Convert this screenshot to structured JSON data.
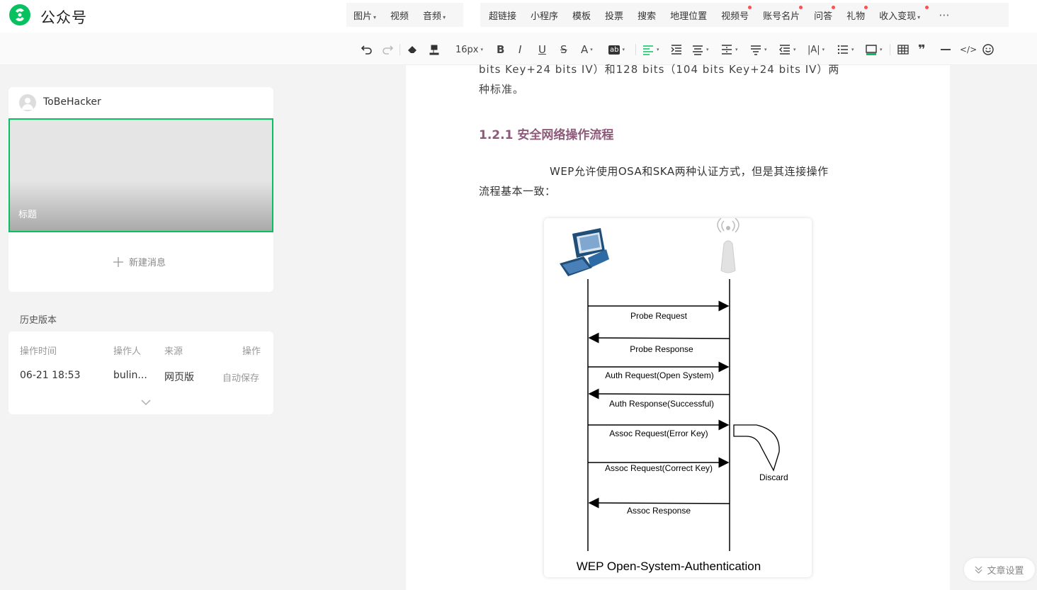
{
  "app": {
    "brand": "公众号"
  },
  "top_menu": {
    "group1": [
      {
        "label": "图片",
        "caret": true
      },
      {
        "label": "视频",
        "caret": false
      },
      {
        "label": "音频",
        "caret": true
      }
    ],
    "group2": [
      {
        "label": "超链接",
        "caret": false,
        "dot": false
      },
      {
        "label": "小程序",
        "caret": false,
        "dot": false
      },
      {
        "label": "模板",
        "caret": false,
        "dot": false
      },
      {
        "label": "投票",
        "caret": false,
        "dot": false
      },
      {
        "label": "搜索",
        "caret": false,
        "dot": false
      },
      {
        "label": "地理位置",
        "caret": false,
        "dot": false
      },
      {
        "label": "视频号",
        "caret": false,
        "dot": true
      },
      {
        "label": "账号名片",
        "caret": false,
        "dot": true
      },
      {
        "label": "问答",
        "caret": false,
        "dot": true
      },
      {
        "label": "礼物",
        "caret": false,
        "dot": true
      },
      {
        "label": "收入变现",
        "caret": true,
        "dot": true
      }
    ],
    "more_label": "···"
  },
  "toolbar": {
    "font_size": "16px"
  },
  "left": {
    "account_name": "ToBeHacker",
    "cover_title": "标题",
    "new_message": "新建消息",
    "history_label": "历史版本",
    "history_headers": {
      "time": "操作时间",
      "operator": "操作人",
      "source": "来源",
      "action": "操作"
    },
    "history_row": {
      "time": "06-21 18:53",
      "operator": "bulin...",
      "source": "网页版",
      "action": "自动保存"
    }
  },
  "editor": {
    "top_text_line1": "bits Key+24 bits IV）和128 bits（104 bits Key+24 bits IV）两",
    "top_text_line2": "种标准。",
    "heading": "1.2.1 安全网络操作流程",
    "body_line1": "WEP允许使用OSA和SKA两种认证方式，但是其连接操作",
    "body_line2": "流程基本一致："
  },
  "diagram": {
    "messages": [
      "Probe Request",
      "Probe Response",
      "Auth Request(Open System)",
      "Auth Response(Successful)",
      "Assoc Request(Error Key)",
      "Assoc Request(Correct Key)",
      "Assoc Response"
    ],
    "discard_label": "Discard",
    "caption": "WEP Open-System-Authentication"
  },
  "settings_button": "文章设置",
  "colors": {
    "accent": "#07c160",
    "heading": "#8e5a7a",
    "dot": "#fa5151"
  }
}
